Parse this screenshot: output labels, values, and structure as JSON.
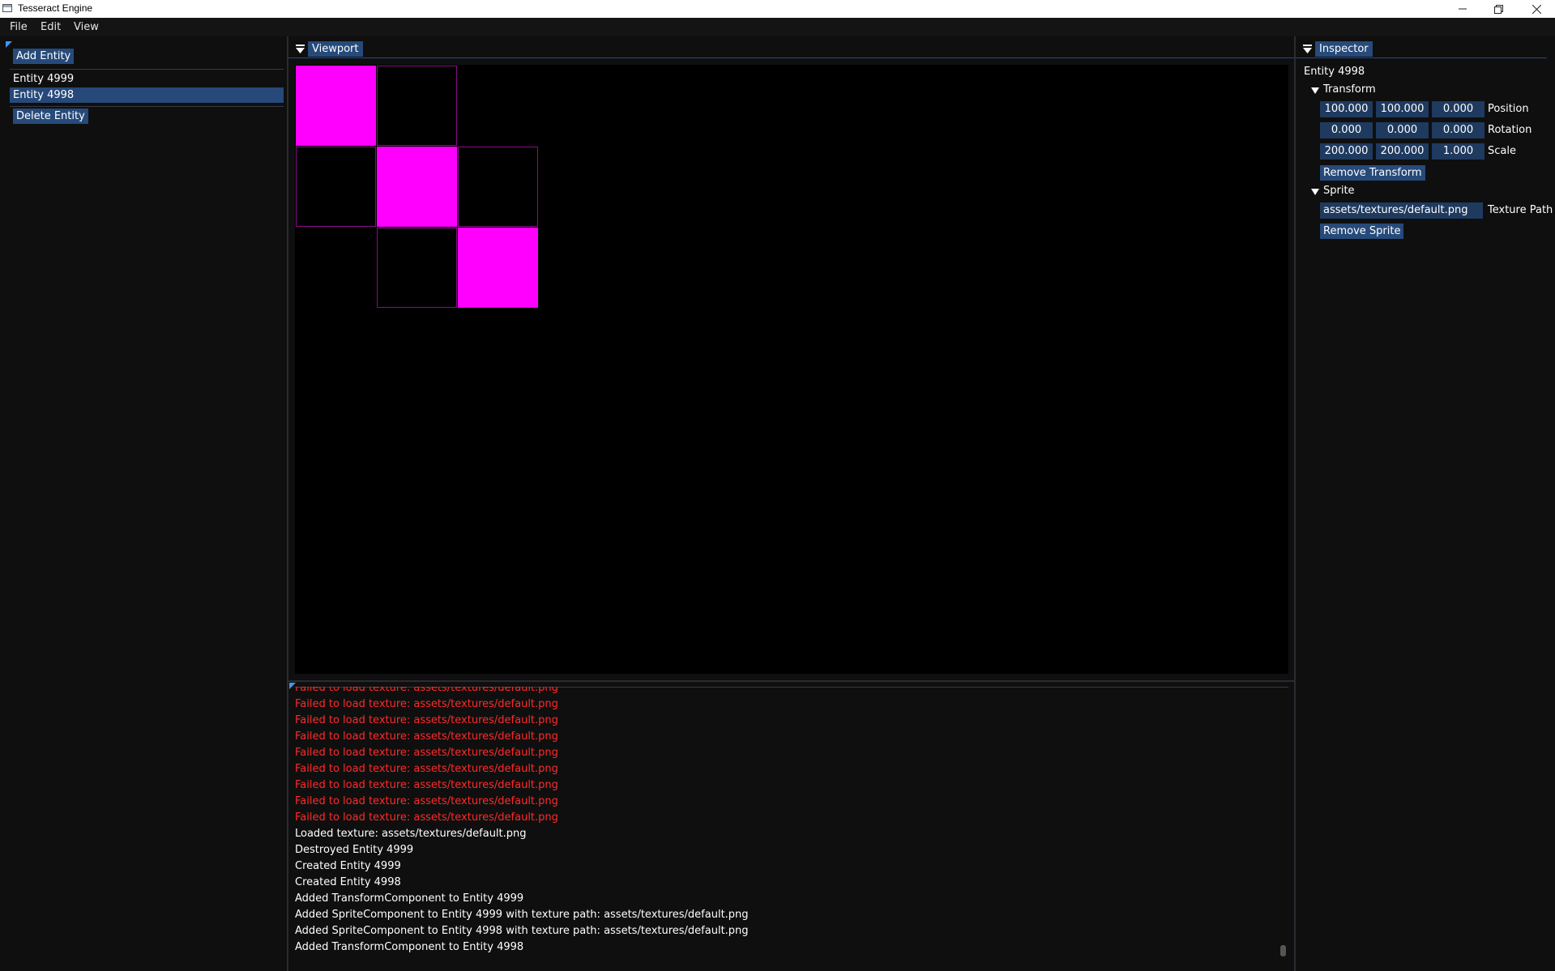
{
  "window": {
    "title": "Tesseract Engine"
  },
  "menu": {
    "items": [
      "File",
      "Edit",
      "View"
    ]
  },
  "hierarchy": {
    "add_button": "Add Entity",
    "delete_button": "Delete Entity",
    "entities": [
      "Entity 4999",
      "Entity 4998"
    ],
    "selected_index": 1
  },
  "viewport": {
    "title": "Viewport",
    "tiles": [
      {
        "col": 0,
        "row": 0,
        "filled": true
      },
      {
        "col": 1,
        "row": 0,
        "filled": false
      },
      {
        "col": 0,
        "row": 1,
        "filled": false
      },
      {
        "col": 1,
        "row": 1,
        "filled": true
      },
      {
        "col": 2,
        "row": 1,
        "filled": false
      },
      {
        "col": 1,
        "row": 2,
        "filled": false
      },
      {
        "col": 2,
        "row": 2,
        "filled": true
      }
    ],
    "colors": {
      "fill": "#ff00ff",
      "outline": "#8a0a8a",
      "background": "#000000"
    }
  },
  "console": {
    "lines": [
      {
        "type": "error",
        "text": "Failed to load texture: assets/textures/default.png"
      },
      {
        "type": "error",
        "text": "Failed to load texture: assets/textures/default.png"
      },
      {
        "type": "error",
        "text": "Failed to load texture: assets/textures/default.png"
      },
      {
        "type": "error",
        "text": "Failed to load texture: assets/textures/default.png"
      },
      {
        "type": "error",
        "text": "Failed to load texture: assets/textures/default.png"
      },
      {
        "type": "error",
        "text": "Failed to load texture: assets/textures/default.png"
      },
      {
        "type": "error",
        "text": "Failed to load texture: assets/textures/default.png"
      },
      {
        "type": "error",
        "text": "Failed to load texture: assets/textures/default.png"
      },
      {
        "type": "error",
        "text": "Failed to load texture: assets/textures/default.png"
      },
      {
        "type": "info",
        "text": "Loaded texture: assets/textures/default.png"
      },
      {
        "type": "info",
        "text": "Destroyed Entity 4999"
      },
      {
        "type": "info",
        "text": "Created Entity 4999"
      },
      {
        "type": "info",
        "text": "Created Entity 4998"
      },
      {
        "type": "info",
        "text": "Added TransformComponent to Entity 4999"
      },
      {
        "type": "info",
        "text": "Added SpriteComponent to Entity 4999 with texture path: assets/textures/default.png"
      },
      {
        "type": "info",
        "text": "Added SpriteComponent to Entity 4998 with texture path: assets/textures/default.png"
      },
      {
        "type": "info",
        "text": "Added TransformComponent to Entity 4998"
      }
    ],
    "colors": {
      "error": "#ff2a2a",
      "info": "#ffffff"
    }
  },
  "inspector": {
    "title": "Inspector",
    "entity_name": "Entity 4998",
    "transform": {
      "header": "Transform",
      "position": {
        "label": "Position",
        "values": [
          "100.000",
          "100.000",
          "0.000"
        ]
      },
      "rotation": {
        "label": "Rotation",
        "values": [
          "0.000",
          "0.000",
          "0.000"
        ]
      },
      "scale": {
        "label": "Scale",
        "values": [
          "200.000",
          "200.000",
          "1.000"
        ]
      },
      "remove_button": "Remove Transform"
    },
    "sprite": {
      "header": "Sprite",
      "texture_path": "assets/textures/default.png",
      "texture_label": "Texture Path",
      "remove_button": "Remove Sprite"
    }
  },
  "theme": {
    "accent": "#264a7a",
    "accent_bright": "#4296fa",
    "background": "#0f0f0f"
  }
}
